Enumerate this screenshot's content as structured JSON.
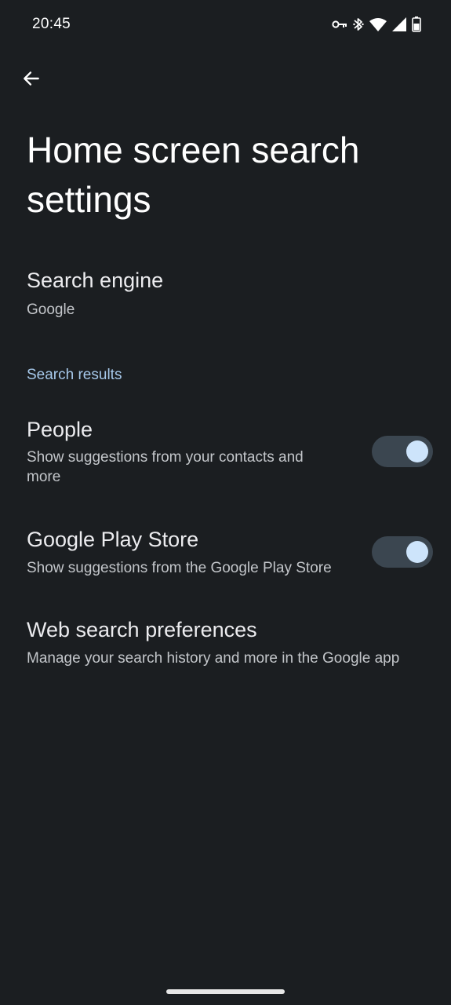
{
  "status_bar": {
    "time": "20:45",
    "icons": [
      "vpn-key-icon",
      "bluetooth-icon",
      "wifi-icon",
      "signal-icon",
      "battery-icon"
    ]
  },
  "toolbar": {
    "back_icon": "arrow-back-icon"
  },
  "page": {
    "title": "Home screen search settings"
  },
  "search_engine": {
    "title": "Search engine",
    "summary": "Google"
  },
  "search_results": {
    "header": "Search results",
    "people": {
      "title": "People",
      "summary": "Show suggestions from your contacts and more",
      "enabled": true
    },
    "play_store": {
      "title": "Google Play Store",
      "summary": "Show suggestions from the Google Play Store",
      "enabled": true
    }
  },
  "web_search": {
    "title": "Web search preferences",
    "summary": "Manage your search history and more in the Google app"
  },
  "colors": {
    "background": "#1b1e21",
    "accent": "#a6c8ea",
    "toggle_track": "#3b4650",
    "toggle_thumb": "#cde4fb"
  }
}
